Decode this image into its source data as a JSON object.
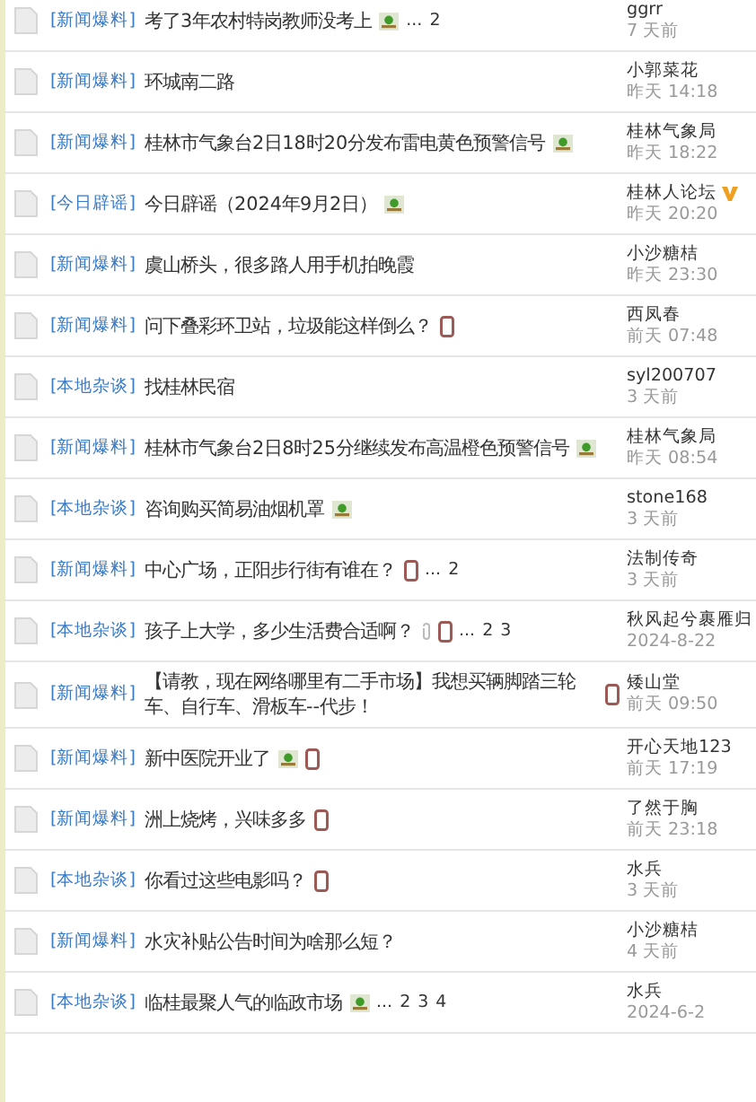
{
  "threads": [
    {
      "category": "[新闻爆料]",
      "title": "考了3年农村特岗教师没考上",
      "icons": [
        {
          "kind": "image"
        }
      ],
      "pages": [
        "...",
        "2"
      ],
      "author": "ggrr",
      "vip": false,
      "time": "7 天前"
    },
    {
      "category": "[新闻爆料]",
      "title": "环城南二路",
      "author": "小郭菜花",
      "vip": false,
      "time": "昨天 14:18"
    },
    {
      "category": "[新闻爆料]",
      "title": "桂林市气象台2日18时20分发布雷电黄色预警信号",
      "icons": [
        {
          "kind": "image"
        }
      ],
      "author": "桂林气象局",
      "vip": false,
      "time": "昨天 18:22"
    },
    {
      "category": "[今日辟谣]",
      "title": "今日辟谣（2024年9月2日）",
      "icons": [
        {
          "kind": "image"
        }
      ],
      "author": "桂林人论坛",
      "vip": true,
      "time": "昨天 20:20"
    },
    {
      "category": "[新闻爆料]",
      "title": "虞山桥头，很多路人用手机拍晚霞",
      "author": "小沙糖桔",
      "vip": false,
      "time": "昨天 23:30"
    },
    {
      "category": "[新闻爆料]",
      "title": "问下叠彩环卫站，垃圾能这样倒么？",
      "icons": [
        {
          "kind": "mobile"
        }
      ],
      "author": "西凤春",
      "vip": false,
      "time": "前天 07:48"
    },
    {
      "category": "[本地杂谈]",
      "title": "找桂林民宿",
      "author": "syl200707",
      "vip": false,
      "time": "3 天前"
    },
    {
      "category": "[新闻爆料]",
      "title": "桂林市气象台2日8时25分继续发布高温橙色预警信号",
      "icons": [
        {
          "kind": "image"
        }
      ],
      "author": "桂林气象局",
      "vip": false,
      "time": "昨天 08:54"
    },
    {
      "category": "[本地杂谈]",
      "title": "咨询购买简易油烟机罩",
      "icons": [
        {
          "kind": "image"
        }
      ],
      "author": "stone168",
      "vip": false,
      "time": "3 天前"
    },
    {
      "category": "[新闻爆料]",
      "title": "中心广场，正阳步行街有谁在？",
      "icons": [
        {
          "kind": "mobile"
        }
      ],
      "pages": [
        "...",
        "2"
      ],
      "author": "法制传奇",
      "vip": false,
      "time": "3 天前"
    },
    {
      "category": "[本地杂谈]",
      "title": "孩子上大学，多少生活费合适啊？",
      "icons": [
        {
          "kind": "attachment"
        },
        {
          "kind": "mobile"
        }
      ],
      "pages": [
        "...",
        "2",
        "3"
      ],
      "author": "秋风起兮裹雁归",
      "time": "2024-8-22"
    },
    {
      "category": "[新闻爆料]",
      "title": "【请教，现在网络哪里有二手市场】我想买辆脚踏三轮车、自行车、滑板车--代步！",
      "icons": [
        {
          "kind": "mobile"
        }
      ],
      "author": "矮山堂",
      "vip": false,
      "time": "前天 09:50"
    },
    {
      "category": "[新闻爆料]",
      "title": "新中医院开业了",
      "icons": [
        {
          "kind": "image"
        },
        {
          "kind": "mobile"
        }
      ],
      "author": "开心天地123",
      "vip": false,
      "time": "前天 17:19"
    },
    {
      "category": "[新闻爆料]",
      "title": "洲上烧烤，兴味多多",
      "icons": [
        {
          "kind": "mobile"
        }
      ],
      "author": "了然于胸",
      "vip": false,
      "time": "前天 23:18"
    },
    {
      "category": "[本地杂谈]",
      "title": "你看过这些电影吗？",
      "icons": [
        {
          "kind": "mobile"
        }
      ],
      "author": "水兵",
      "vip": false,
      "time": "3 天前"
    },
    {
      "category": "[新闻爆料]",
      "title": "水灾补贴公告时间为啥那么短？",
      "author": "小沙糖桔",
      "vip": false,
      "time": "4 天前"
    },
    {
      "category": "[本地杂谈]",
      "title": "临桂最聚人气的临政市场",
      "icons": [
        {
          "kind": "image"
        }
      ],
      "pages": [
        "...",
        "2",
        "3",
        "4"
      ],
      "author": "水兵",
      "vip": false,
      "time": "2024-6-2"
    }
  ]
}
